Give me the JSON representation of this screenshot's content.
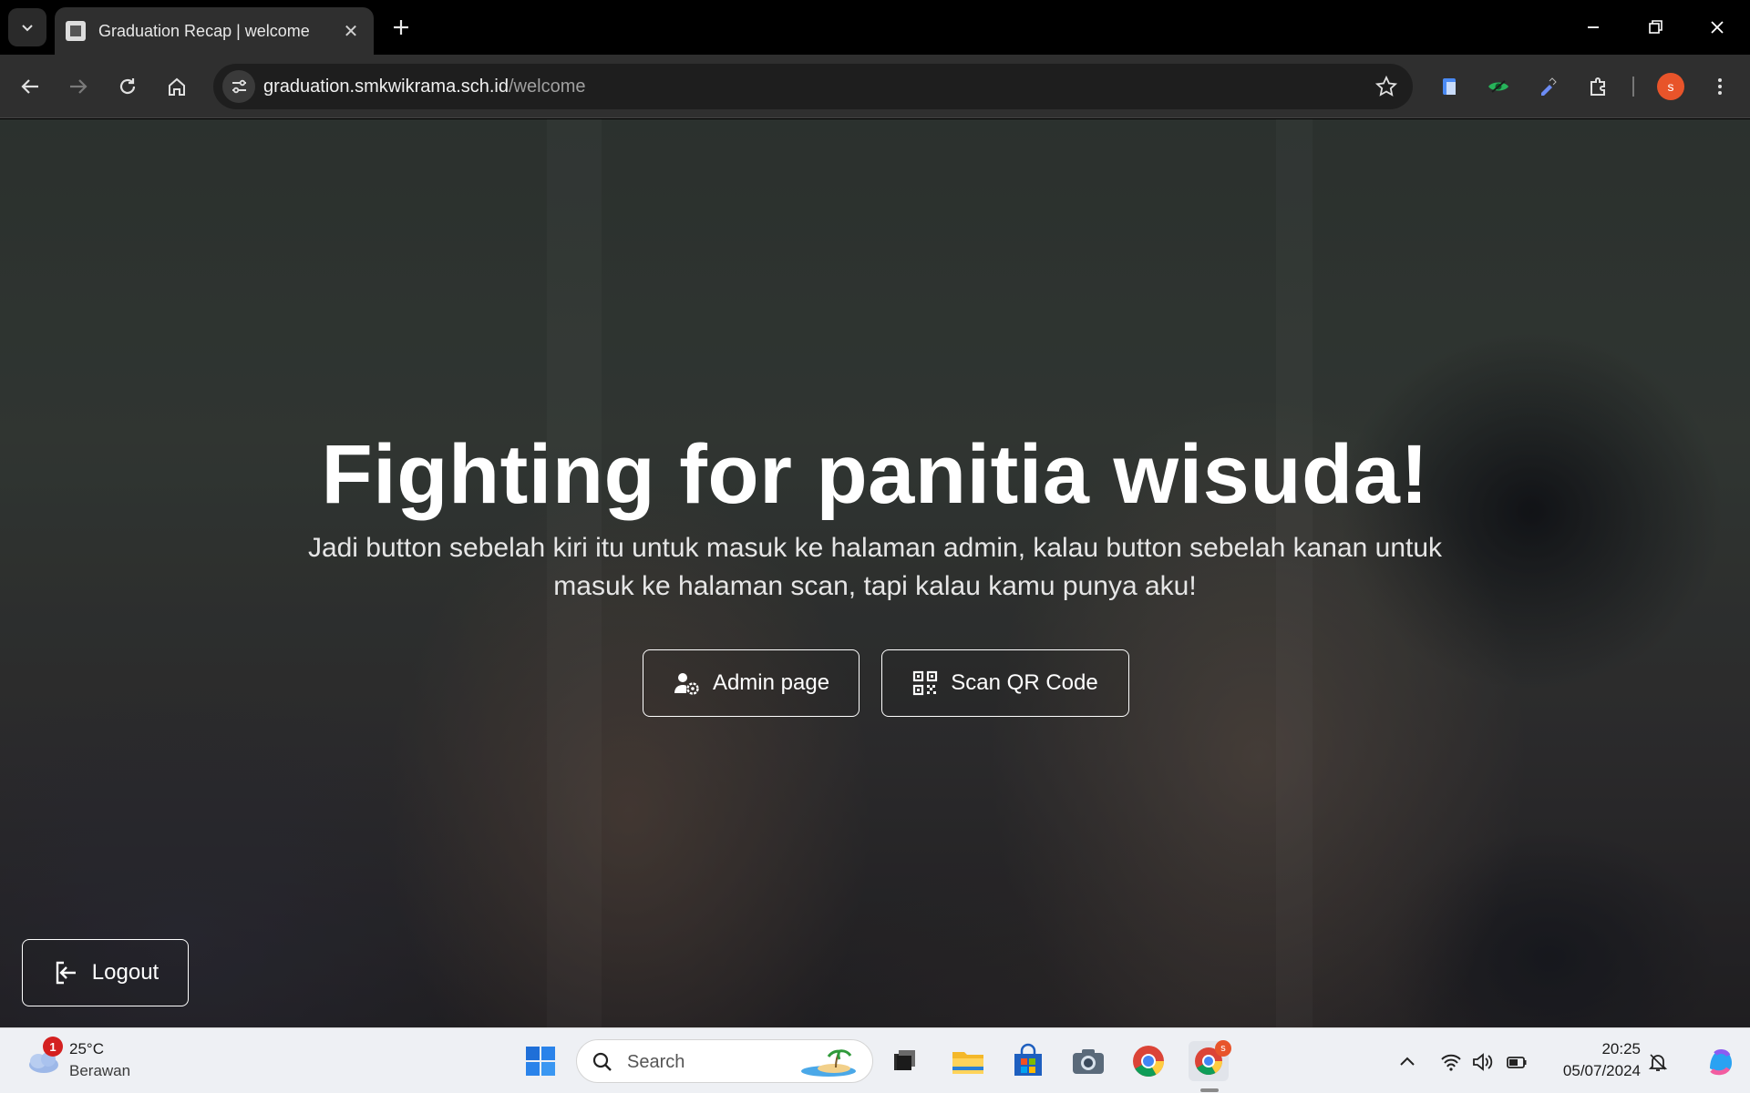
{
  "browser": {
    "tab_title": "Graduation Recap | welcome",
    "url_host": "graduation.smkwikrama.sch.id",
    "url_path": "/welcome",
    "profile_initial": "s"
  },
  "hero": {
    "title": "Fighting for panitia wisuda!",
    "subtitle": "Jadi button sebelah kiri itu untuk masuk ke halaman admin, kalau button sebelah kanan untuk masuk ke halaman scan, tapi kalau kamu punya aku!",
    "admin_button": "Admin page",
    "scan_button": "Scan QR Code",
    "logout_button": "Logout"
  },
  "taskbar": {
    "weather_badge": "1",
    "weather_temp": "25°C",
    "weather_desc": "Berawan",
    "search_label": "Search",
    "chrome_badge": "s",
    "time": "20:25",
    "date": "05/07/2024"
  },
  "colors": {
    "accent_avatar": "#e8542a",
    "button_border": "#ffffff"
  }
}
